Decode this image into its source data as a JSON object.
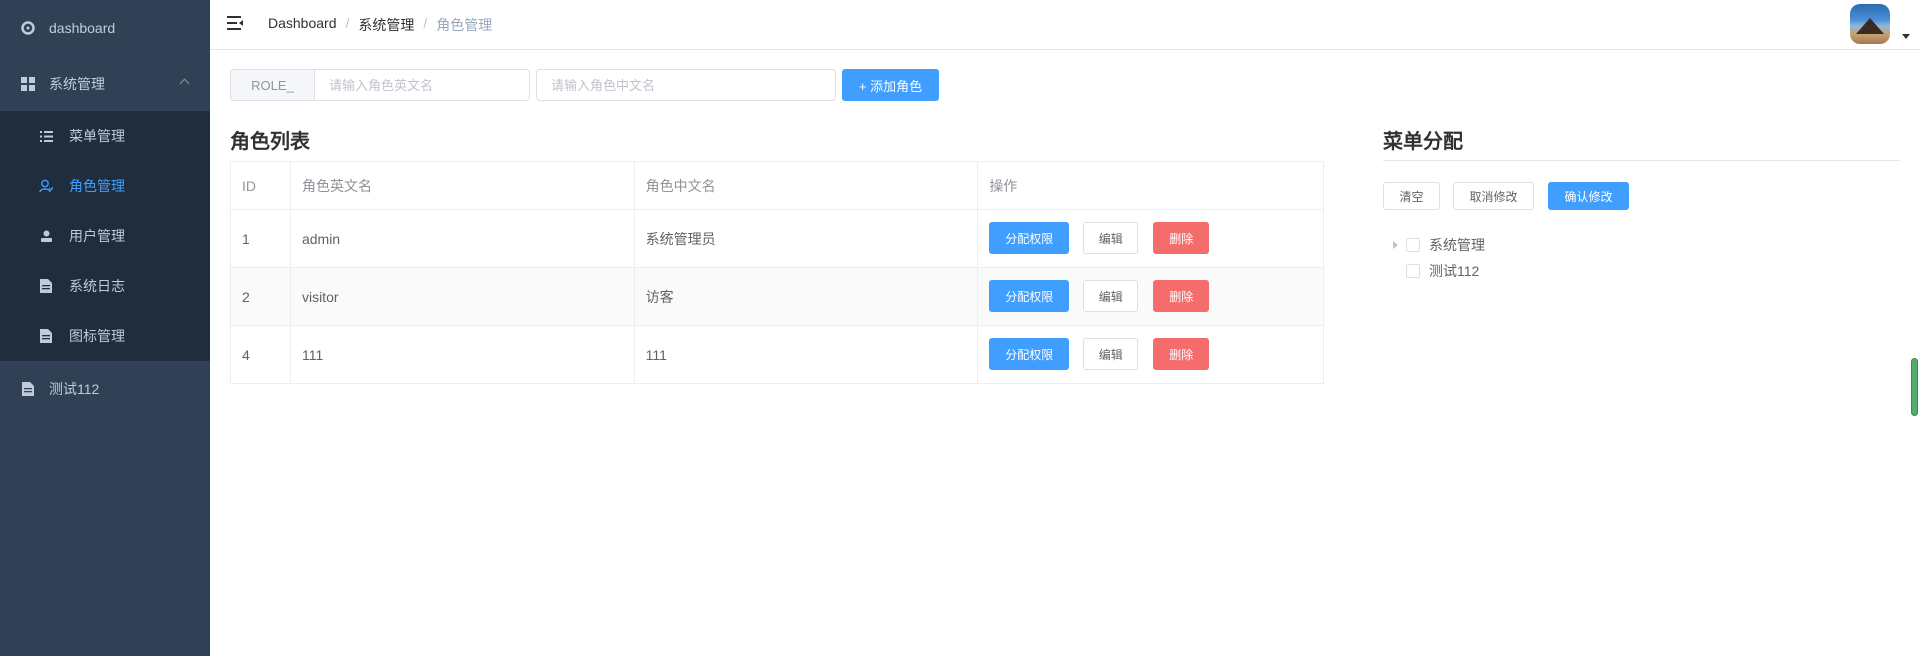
{
  "sidebar": {
    "items": [
      {
        "label": "dashboard",
        "icon": "dashboard-icon"
      },
      {
        "label": "系统管理",
        "icon": "grid-icon"
      },
      {
        "label": "测试112",
        "icon": "document-icon"
      }
    ],
    "sub_items": [
      {
        "label": "菜单管理",
        "icon": "list-icon"
      },
      {
        "label": "角色管理",
        "icon": "user-role-icon"
      },
      {
        "label": "用户管理",
        "icon": "user-icon"
      },
      {
        "label": "系统日志",
        "icon": "document-icon"
      },
      {
        "label": "图标管理",
        "icon": "document-icon"
      }
    ],
    "active": "角色管理",
    "colors": {
      "bg": "#304156",
      "sub_bg": "#1f2d3d",
      "text": "#bfcbd9",
      "active": "#409eff"
    }
  },
  "navbar": {
    "breadcrumb": [
      "Dashboard",
      "系统管理",
      "角色管理"
    ],
    "separator": "/"
  },
  "toolbar": {
    "prefix": "ROLE_",
    "en_placeholder": "请输入角色英文名",
    "cn_placeholder": "请输入角色中文名",
    "add_label": "+ 添加角色"
  },
  "role_list": {
    "title": "角色列表",
    "columns": [
      "ID",
      "角色英文名",
      "角色中文名",
      "操作"
    ],
    "rows": [
      {
        "id": "1",
        "en": "admin",
        "cn": "系统管理员"
      },
      {
        "id": "2",
        "en": "visitor",
        "cn": "访客"
      },
      {
        "id": "4",
        "en": "111",
        "cn": "111"
      }
    ],
    "actions": {
      "assign": "分配权限",
      "edit": "编辑",
      "delete": "删除"
    }
  },
  "menu_assign": {
    "title": "菜单分配",
    "clear_label": "清空",
    "cancel_label": "取消修改",
    "confirm_label": "确认修改",
    "tree": [
      "系统管理",
      "测试112"
    ]
  }
}
